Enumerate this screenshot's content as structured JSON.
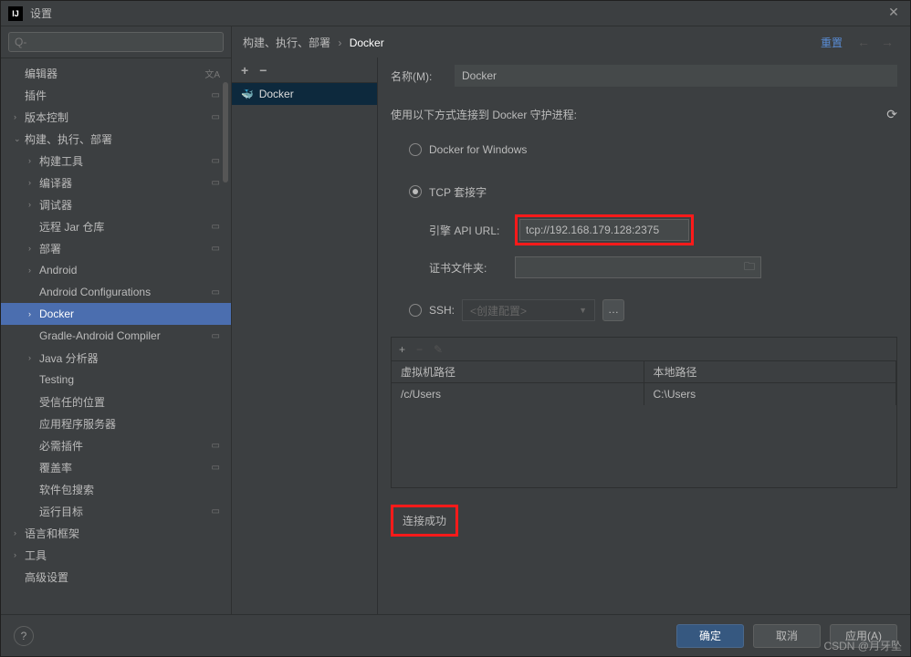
{
  "window": {
    "title": "设置"
  },
  "search": {
    "placeholder": "Q-"
  },
  "tree": [
    {
      "label": "编辑器",
      "depth": 0,
      "chev": "",
      "cfg": false,
      "lang": true
    },
    {
      "label": "插件",
      "depth": 0,
      "chev": "",
      "cfg": true,
      "lang": false
    },
    {
      "label": "版本控制",
      "depth": 0,
      "chev": "›",
      "cfg": true,
      "lang": false
    },
    {
      "label": "构建、执行、部署",
      "depth": 0,
      "chev": "⌄",
      "cfg": false,
      "lang": false
    },
    {
      "label": "构建工具",
      "depth": 1,
      "chev": "›",
      "cfg": true,
      "lang": false
    },
    {
      "label": "编译器",
      "depth": 1,
      "chev": "›",
      "cfg": true,
      "lang": false
    },
    {
      "label": "调试器",
      "depth": 1,
      "chev": "›",
      "cfg": false,
      "lang": false
    },
    {
      "label": "远程 Jar 仓库",
      "depth": 1,
      "chev": "",
      "cfg": true,
      "lang": false
    },
    {
      "label": "部署",
      "depth": 1,
      "chev": "›",
      "cfg": true,
      "lang": false
    },
    {
      "label": "Android",
      "depth": 1,
      "chev": "›",
      "cfg": false,
      "lang": false
    },
    {
      "label": "Android Configurations",
      "depth": 1,
      "chev": "",
      "cfg": true,
      "lang": false
    },
    {
      "label": "Docker",
      "depth": 1,
      "chev": "›",
      "cfg": false,
      "lang": false,
      "selected": true
    },
    {
      "label": "Gradle-Android Compiler",
      "depth": 1,
      "chev": "",
      "cfg": true,
      "lang": false
    },
    {
      "label": "Java 分析器",
      "depth": 1,
      "chev": "›",
      "cfg": false,
      "lang": false
    },
    {
      "label": "Testing",
      "depth": 1,
      "chev": "",
      "cfg": false,
      "lang": false
    },
    {
      "label": "受信任的位置",
      "depth": 1,
      "chev": "",
      "cfg": false,
      "lang": false
    },
    {
      "label": "应用程序服务器",
      "depth": 1,
      "chev": "",
      "cfg": false,
      "lang": false
    },
    {
      "label": "必需插件",
      "depth": 1,
      "chev": "",
      "cfg": true,
      "lang": false
    },
    {
      "label": "覆盖率",
      "depth": 1,
      "chev": "",
      "cfg": true,
      "lang": false
    },
    {
      "label": "软件包搜索",
      "depth": 1,
      "chev": "",
      "cfg": false,
      "lang": false
    },
    {
      "label": "运行目标",
      "depth": 1,
      "chev": "",
      "cfg": true,
      "lang": false
    },
    {
      "label": "语言和框架",
      "depth": 0,
      "chev": "›",
      "cfg": false,
      "lang": false
    },
    {
      "label": "工具",
      "depth": 0,
      "chev": "›",
      "cfg": false,
      "lang": false
    },
    {
      "label": "高级设置",
      "depth": 0,
      "chev": "",
      "cfg": false,
      "lang": false
    }
  ],
  "breadcrumb": {
    "parent": "构建、执行、部署",
    "current": "Docker",
    "reset": "重置"
  },
  "conn_list": {
    "selected": "Docker"
  },
  "form": {
    "name_label": "名称(M):",
    "name_value": "Docker",
    "connect_label": "使用以下方式连接到 Docker 守护进程:",
    "radio_win": "Docker for Windows",
    "radio_tcp": "TCP 套接字",
    "radio_ssh": "SSH:",
    "api_url_label": "引擎 API URL:",
    "api_url_value": "tcp://192.168.179.128:2375",
    "cert_label": "证书文件夹:",
    "ssh_placeholder": "<创建配置>",
    "map_vm_head": "虚拟机路径",
    "map_local_head": "本地路径",
    "map_vm_val": "/c/Users",
    "map_local_val": "C:\\Users",
    "status": "连接成功"
  },
  "buttons": {
    "ok": "确定",
    "cancel": "取消",
    "apply": "应用(A)"
  },
  "watermark": "CSDN @月牙坠"
}
